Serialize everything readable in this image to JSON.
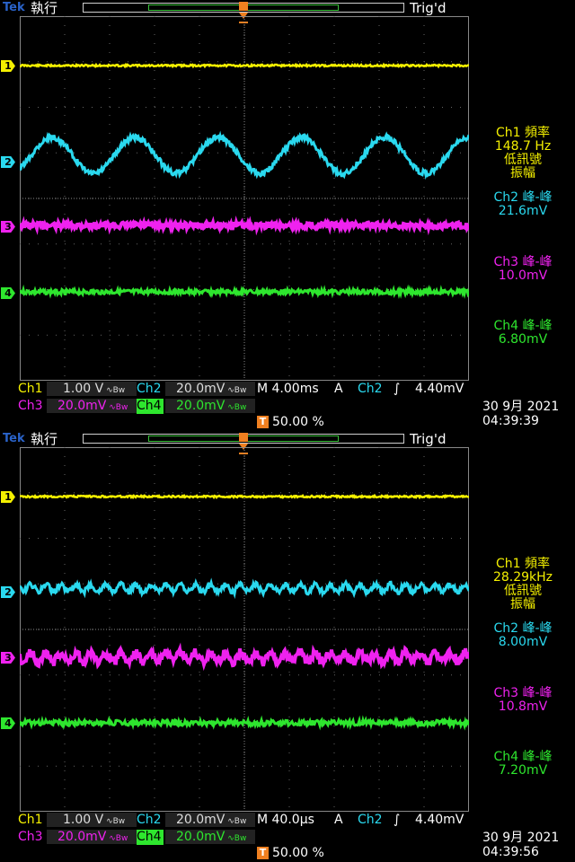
{
  "colors": {
    "ch1": "#f4f000",
    "ch2": "#2ad9ef",
    "ch3": "#ef22ef",
    "ch4": "#2ee62e",
    "trigger": "#f08020",
    "grid": "#777777"
  },
  "brand": "Tek",
  "run_state": "執行",
  "trig_status": "Trig'd",
  "screens": [
    {
      "measurements": {
        "ch1_title": "Ch1 頻率",
        "ch1_value": "148.7 Hz",
        "ch1_note1": "低訊號",
        "ch1_note2": "振幅",
        "ch2_title": "Ch2 峰-峰",
        "ch2_value": "21.6mV",
        "ch3_title": "Ch3 峰-峰",
        "ch3_value": "10.0mV",
        "ch4_title": "Ch4 峰-峰",
        "ch4_value": "6.80mV"
      },
      "status": {
        "ch1_label": "Ch1",
        "ch1_scale": "1.00 V",
        "ch2_label": "Ch2",
        "ch2_scale": "20.0mV",
        "ch3_label": "Ch3",
        "ch3_scale": "20.0mV",
        "ch4_label": "Ch4",
        "ch4_scale": "20.0mV",
        "timebase": "M 4.00ms",
        "trig_mode": "A",
        "trig_source": "Ch2",
        "trig_slope": "∫",
        "trig_level": "4.40mV",
        "trig_position": "50.00 %",
        "date": "30 9月  2021",
        "time": "04:39:39"
      }
    },
    {
      "measurements": {
        "ch1_title": "Ch1 頻率",
        "ch1_value": "28.29kHz",
        "ch1_note1": "低訊號",
        "ch1_note2": "振幅",
        "ch2_title": "Ch2 峰-峰",
        "ch2_value": "8.00mV",
        "ch3_title": "Ch3 峰-峰",
        "ch3_value": "10.8mV",
        "ch4_title": "Ch4 峰-峰",
        "ch4_value": "7.20mV"
      },
      "status": {
        "ch1_label": "Ch1",
        "ch1_scale": "1.00 V",
        "ch2_label": "Ch2",
        "ch2_scale": "20.0mV",
        "ch3_label": "Ch3",
        "ch3_scale": "20.0mV",
        "ch4_label": "Ch4",
        "ch4_scale": "20.0mV",
        "timebase": "M 40.0µs",
        "trig_mode": "A",
        "trig_source": "Ch2",
        "trig_slope": "∫",
        "trig_level": "4.40mV",
        "trig_position": "50.00 %",
        "date": "30 9月  2021",
        "time": "04:39:56"
      }
    }
  ],
  "channel_markers": [
    "1",
    "2",
    "3",
    "4"
  ],
  "trigger_marker": "T"
}
